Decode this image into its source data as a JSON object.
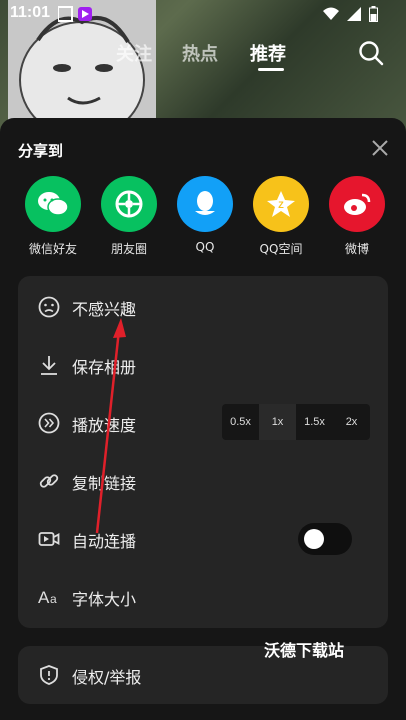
{
  "status_bar": {
    "time": "11:01"
  },
  "top_nav": {
    "tabs": [
      "关注",
      "热点",
      "推荐"
    ],
    "active_index": 2
  },
  "sheet": {
    "title": "分享到",
    "share_targets": [
      {
        "label": "微信好友",
        "icon": "wechat-icon",
        "color": "#07c160"
      },
      {
        "label": "朋友圈",
        "icon": "moments-icon",
        "color": "#07c160"
      },
      {
        "label": "QQ",
        "icon": "qq-icon",
        "color": "#12a0f7"
      },
      {
        "label": "QQ空间",
        "icon": "qzone-icon",
        "color": "#f7c21a"
      },
      {
        "label": "微博",
        "icon": "weibo-icon",
        "color": "#e6162d"
      }
    ],
    "options": {
      "not_interested": "不感兴趣",
      "save_album": "保存相册",
      "playback_speed": {
        "label": "播放速度",
        "options": [
          "0.5x",
          "1x",
          "1.5x",
          "2x"
        ],
        "selected": "1x"
      },
      "copy_link": "复制链接",
      "autoplay": {
        "label": "自动连播",
        "enabled": false
      },
      "font_size": "字体大小"
    },
    "report": "侵权/举报"
  },
  "watermark": "沃德下载站"
}
